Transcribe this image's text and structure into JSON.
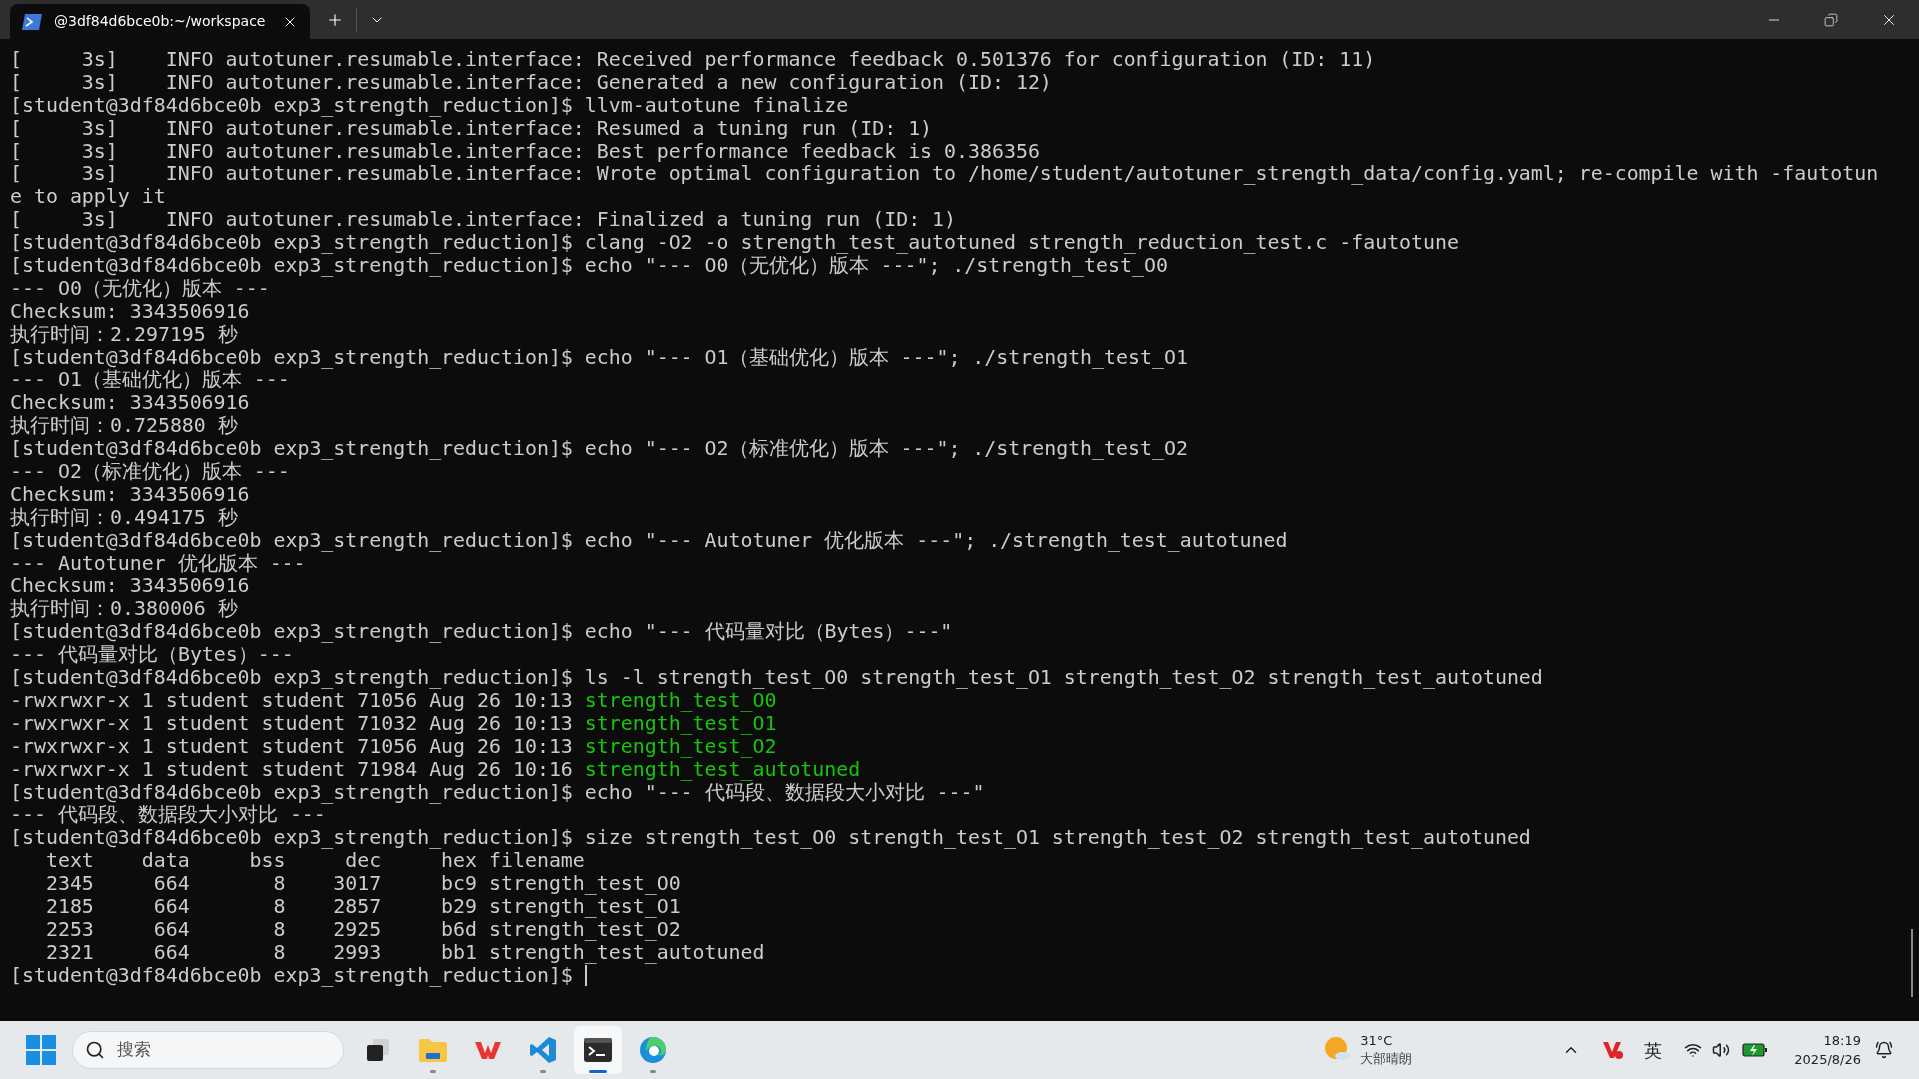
{
  "tab": {
    "title": "@3df84d6bce0b:~/workspace",
    "selected": true
  },
  "terminal": {
    "lines": [
      {
        "text": "[     3s]    INFO autotuner.resumable.interface: Received performance feedback 0.501376 for configuration (ID: 11)"
      },
      {
        "text": "[     3s]    INFO autotuner.resumable.interface: Generated a new configuration (ID: 12)"
      },
      {
        "text": "[student@3df84d6bce0b exp3_strength_reduction]$ llvm-autotune finalize"
      },
      {
        "text": "[     3s]    INFO autotuner.resumable.interface: Resumed a tuning run (ID: 1)"
      },
      {
        "text": "[     3s]    INFO autotuner.resumable.interface: Best performance feedback is 0.386356"
      },
      {
        "text": "[     3s]    INFO autotuner.resumable.interface: Wrote optimal configuration to /home/student/autotuner_strength_data/config.yaml; re-compile with -fautotun"
      },
      {
        "text": "e to apply it"
      },
      {
        "text": "[     3s]    INFO autotuner.resumable.interface: Finalized a tuning run (ID: 1)"
      },
      {
        "text": "[student@3df84d6bce0b exp3_strength_reduction]$ clang -O2 -o strength_test_autotuned strength_reduction_test.c -fautotune"
      },
      {
        "text": "[student@3df84d6bce0b exp3_strength_reduction]$ echo \"--- O0（无优化）版本 ---\"; ./strength_test_O0"
      },
      {
        "text": "--- O0（无优化）版本 ---"
      },
      {
        "text": "Checksum: 3343506916"
      },
      {
        "text": "执行时间：2.297195 秒"
      },
      {
        "text": "[student@3df84d6bce0b exp3_strength_reduction]$ echo \"--- O1（基础优化）版本 ---\"; ./strength_test_O1"
      },
      {
        "text": "--- O1（基础优化）版本 ---"
      },
      {
        "text": "Checksum: 3343506916"
      },
      {
        "text": "执行时间：0.725880 秒"
      },
      {
        "text": "[student@3df84d6bce0b exp3_strength_reduction]$ echo \"--- O2（标准优化）版本 ---\"; ./strength_test_O2"
      },
      {
        "text": "--- O2（标准优化）版本 ---"
      },
      {
        "text": "Checksum: 3343506916"
      },
      {
        "text": "执行时间：0.494175 秒"
      },
      {
        "text": "[student@3df84d6bce0b exp3_strength_reduction]$ echo \"--- Autotuner 优化版本 ---\"; ./strength_test_autotuned"
      },
      {
        "text": "--- Autotuner 优化版本 ---"
      },
      {
        "text": "Checksum: 3343506916"
      },
      {
        "text": "执行时间：0.380006 秒"
      },
      {
        "text": "[student@3df84d6bce0b exp3_strength_reduction]$ echo \"--- 代码量对比（Bytes）---\""
      },
      {
        "text": "--- 代码量对比（Bytes）---"
      },
      {
        "text": "[student@3df84d6bce0b exp3_strength_reduction]$ ls -l strength_test_O0 strength_test_O1 strength_test_O2 strength_test_autotuned"
      },
      {
        "text": "-rwxrwxr-x 1 student student 71056 Aug 26 10:13 ",
        "file": "strength_test_O0"
      },
      {
        "text": "-rwxrwxr-x 1 student student 71032 Aug 26 10:13 ",
        "file": "strength_test_O1"
      },
      {
        "text": "-rwxrwxr-x 1 student student 71056 Aug 26 10:13 ",
        "file": "strength_test_O2"
      },
      {
        "text": "-rwxrwxr-x 1 student student 71984 Aug 26 10:16 ",
        "file": "strength_test_autotuned"
      },
      {
        "text": "[student@3df84d6bce0b exp3_strength_reduction]$ echo \"--- 代码段、数据段大小对比 ---\""
      },
      {
        "text": "--- 代码段、数据段大小对比 ---"
      },
      {
        "text": "[student@3df84d6bce0b exp3_strength_reduction]$ size strength_test_O0 strength_test_O1 strength_test_O2 strength_test_autotuned"
      },
      {
        "text": "   text    data     bss     dec     hex filename"
      },
      {
        "text": "   2345     664       8    3017     bc9 strength_test_O0"
      },
      {
        "text": "   2185     664       8    2857     b29 strength_test_O1"
      },
      {
        "text": "   2253     664       8    2925     b6d strength_test_O2"
      },
      {
        "text": "   2321     664       8    2993     bb1 strength_test_autotuned"
      },
      {
        "text": "[student@3df84d6bce0b exp3_strength_reduction]$ ",
        "cursor": true
      }
    ]
  },
  "taskbar": {
    "search": {
      "placeholder": "搜索"
    },
    "apps": [
      {
        "kind": "taskview",
        "running": false,
        "selected": false
      },
      {
        "kind": "explorer",
        "running": true,
        "selected": false
      },
      {
        "kind": "wps",
        "running": false,
        "selected": false
      },
      {
        "kind": "vscode",
        "running": true,
        "selected": false
      },
      {
        "kind": "terminal",
        "running": true,
        "selected": true
      },
      {
        "kind": "edge",
        "running": true,
        "selected": false
      }
    ],
    "weather": {
      "temperature": "31°C",
      "condition": "大部晴朗"
    },
    "ime": "英",
    "time": "18:19",
    "date": "2025/8/26"
  }
}
